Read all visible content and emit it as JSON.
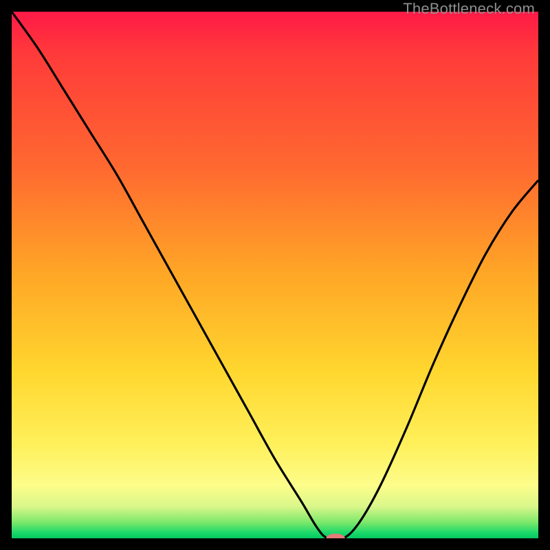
{
  "attribution": "TheBottleneck.com",
  "chart_data": {
    "type": "line",
    "title": "",
    "xlabel": "",
    "ylabel": "",
    "xlim": [
      0,
      100
    ],
    "ylim": [
      0,
      100
    ],
    "series": [
      {
        "name": "bottleneck-curve",
        "x": [
          0,
          5,
          10,
          15,
          20,
          25,
          30,
          35,
          40,
          45,
          50,
          55,
          58,
          60,
          63,
          66,
          70,
          75,
          80,
          85,
          90,
          95,
          100
        ],
        "values": [
          100,
          93,
          85,
          77,
          69,
          60,
          51,
          42,
          33,
          24,
          15,
          7,
          2,
          0,
          0,
          3,
          10,
          21,
          33,
          44,
          54,
          62,
          68
        ]
      }
    ],
    "marker": {
      "x": 61.5,
      "y": 0,
      "rx": 1.8,
      "ry": 0.9,
      "color": "#e37b79"
    },
    "gradient_stops": [
      {
        "pos": 0,
        "color": "#ff1a47"
      },
      {
        "pos": 50,
        "color": "#ffa726"
      },
      {
        "pos": 82,
        "color": "#fff05a"
      },
      {
        "pos": 100,
        "color": "#06c95f"
      }
    ]
  }
}
